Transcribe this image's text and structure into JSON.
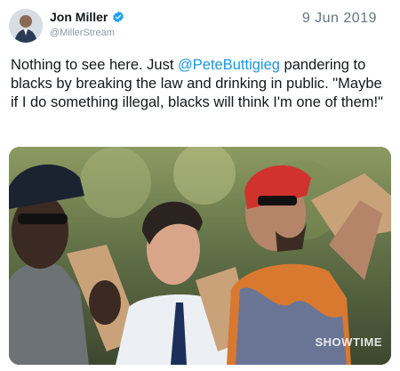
{
  "author": {
    "display_name": "Jon Miller",
    "handle": "@MillerStream",
    "avatar_icon": "profile-photo",
    "verified_icon": "verified-badge-icon"
  },
  "tweet": {
    "date": "9 Jun 2019",
    "text_before": "Nothing to see here. Just ",
    "mention": "@PeteButtigieg",
    "text_after": " pandering to blacks by breaking the law and drinking in public. \"Maybe if I do something illegal, blacks will think I'm one of them!\""
  },
  "media": {
    "watermark": "SHOWTIME",
    "description_icon": "photo"
  },
  "colors": {
    "mention": "#1b95e0",
    "verified": "#1da1f2",
    "text": "#14171a",
    "secondary": "#657786"
  }
}
